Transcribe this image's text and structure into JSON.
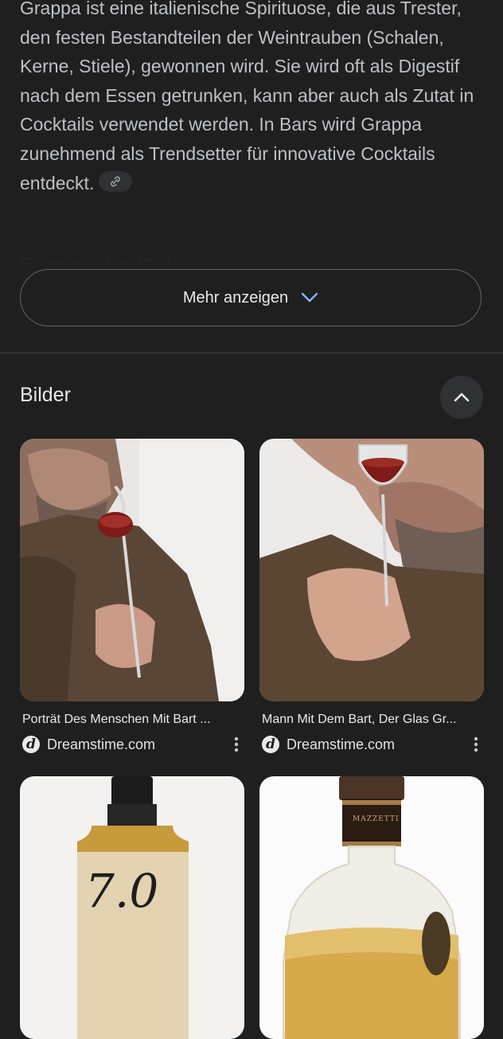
{
  "description": {
    "text": "Grappa ist eine italienische Spirituose, die aus Trester, den festen Bestandteilen der Weintrauben (Schalen, Kerne, Stiele), gewonnen wird. Sie wird oft als Digestif nach dem Essen getrunken, kann aber auch als Zutat in Cocktails verwendet werden. In Bars wird Grappa zunehmend als Trendsetter für innovative Cocktails entdeckt.",
    "next_heading": "Grappa in Cocktails:"
  },
  "more_button": {
    "label": "Mehr anzeigen"
  },
  "images_section": {
    "title": "Bilder",
    "items": [
      {
        "caption": "Porträt Des Menschen Mit Bart ...",
        "source": "Dreamstime.com",
        "favicon_letter": "d"
      },
      {
        "caption": "Mann Mit Dem Bart, Der Glas Gr...",
        "source": "Dreamstime.com",
        "favicon_letter": "d"
      },
      {
        "bottle_label": "7.0"
      },
      {
        "bottle_label": "MAZZETTI"
      }
    ]
  },
  "icons": {
    "link": "link-icon",
    "chevron_down": "chevron-down-icon",
    "chevron_up": "chevron-up-icon",
    "more_vert": "more-vert-icon"
  },
  "colors": {
    "background": "#1f1f1f",
    "text_secondary": "#bdc1c6",
    "button_border": "#5f6368",
    "chip_bg": "#303134"
  }
}
